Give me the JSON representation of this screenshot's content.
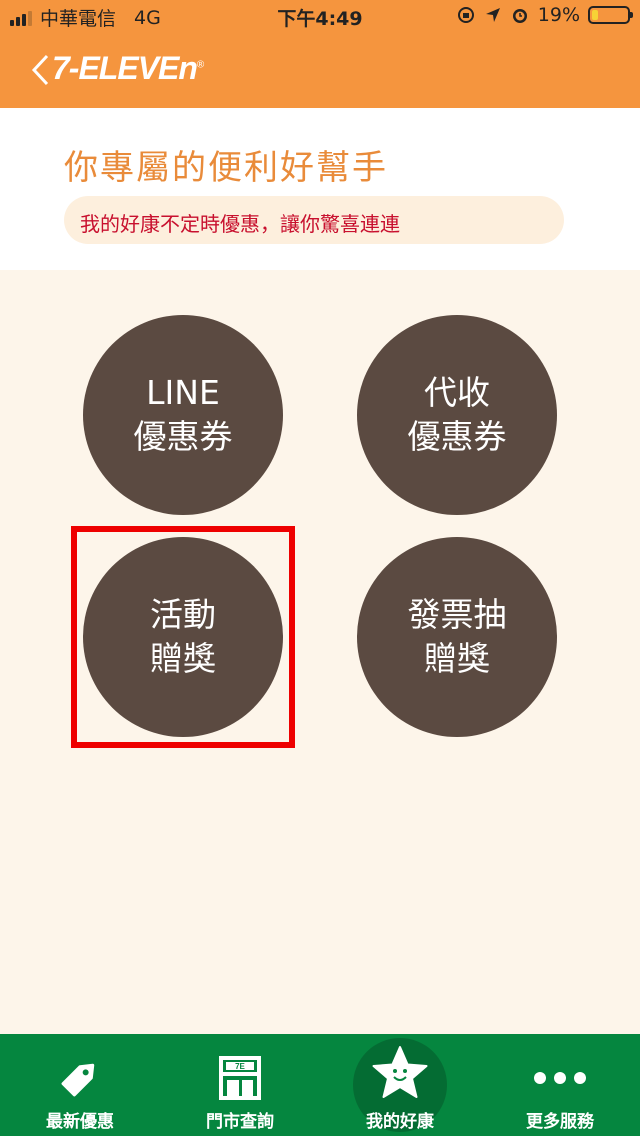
{
  "status_bar": {
    "carrier": "中華電信",
    "network": "4G",
    "time": "下午4:49",
    "battery": "19%",
    "battery_level": 0.19
  },
  "nav": {
    "brand": "7-ELEVEn"
  },
  "header": {
    "title": "你專屬的便利好幫手",
    "subtitle": "我的好康不定時優惠，讓你驚喜連連"
  },
  "buttons": [
    {
      "line1": "LINE",
      "line2": "優惠券"
    },
    {
      "line1": "代收",
      "line2": "優惠券"
    },
    {
      "line1": "活動",
      "line2": "贈獎"
    },
    {
      "line1": "發票抽",
      "line2": "贈獎"
    }
  ],
  "tabs": [
    {
      "label": "最新優惠",
      "icon": "tag-icon"
    },
    {
      "label": "門市查詢",
      "icon": "store-icon"
    },
    {
      "label": "我的好康",
      "icon": "star-icon",
      "selected": true
    },
    {
      "label": "更多服務",
      "icon": "more-dots-icon"
    }
  ],
  "colors": {
    "brand_orange": "#f5953e",
    "circle_brown": "#5b4a41",
    "tab_green": "#05863f",
    "highlight_red": "#ee0000"
  }
}
